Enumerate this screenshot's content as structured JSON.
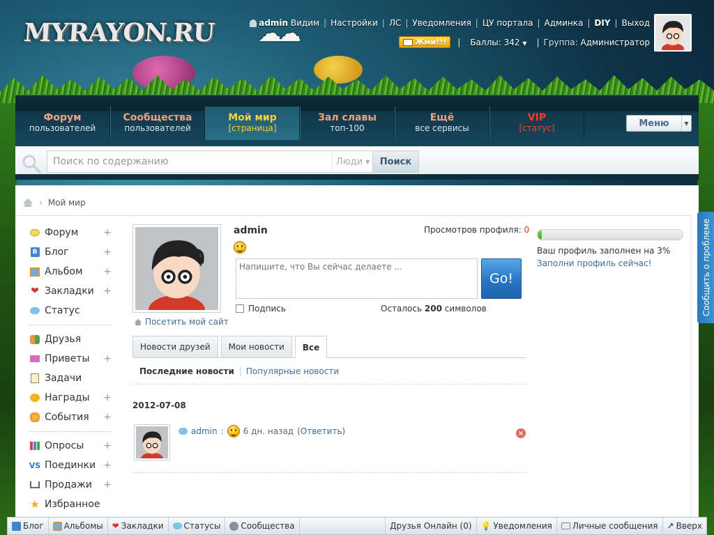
{
  "logo": "MYRAYON.RU",
  "top_bar": {
    "username": "admin",
    "links": [
      "Видим",
      "Настройки",
      "ЛС",
      "Уведомления",
      "ЦУ портала",
      "Админка",
      "DIY",
      "Выход"
    ],
    "push_button": "Жми!!!",
    "points_label": "Баллы: 342",
    "group_label": "Группа:",
    "group_value": "Администратор"
  },
  "main_nav": [
    {
      "title": "Форум",
      "subtitle": "пользователей"
    },
    {
      "title": "Сообщества",
      "subtitle": "пользователей"
    },
    {
      "title": "Мой мир",
      "subtitle": "[страница]"
    },
    {
      "title": "Зал славы",
      "subtitle": "топ-100"
    },
    {
      "title": "Ещё",
      "subtitle": "все сервисы"
    },
    {
      "title": "VIP",
      "subtitle": "[статус]"
    }
  ],
  "menu_button": "Меню",
  "search": {
    "placeholder": "Поиск по содержанию",
    "scope": "Люди",
    "button": "Поиск"
  },
  "breadcrumb": {
    "current": "Мой мир"
  },
  "left_menu": {
    "group1": [
      {
        "label": "Форум",
        "plus": "+"
      },
      {
        "label": "Блог",
        "plus": "+"
      },
      {
        "label": "Альбом",
        "plus": "+"
      },
      {
        "label": "Закладки",
        "plus": "+"
      },
      {
        "label": "Статус",
        "plus": ""
      }
    ],
    "group2": [
      {
        "label": "Друзья",
        "plus": ""
      },
      {
        "label": "Приветы",
        "plus": "+"
      },
      {
        "label": "Задачи",
        "plus": ""
      },
      {
        "label": "Награды",
        "plus": "+"
      },
      {
        "label": "События",
        "plus": "+"
      }
    ],
    "group3": [
      {
        "label": "Опросы",
        "plus": "+"
      },
      {
        "label": "Поединки",
        "plus": "+"
      },
      {
        "label": "Продажи",
        "plus": "+"
      },
      {
        "label": "Избранное",
        "plus": ""
      }
    ]
  },
  "profile": {
    "name": "admin",
    "views_label": "Просмотров профиля:",
    "views_count": "0",
    "status_placeholder": "Напишите, что Вы сейчас делаете ...",
    "go_button": "Go!",
    "sign_label": "Подпись",
    "chars_prefix": "Осталось",
    "chars_count": "200",
    "chars_suffix": "символов",
    "visit_site": "Посетить мой сайт",
    "completion_fraction": 0.03,
    "completion_text": "Ваш профиль заполнен на 3%",
    "completion_link": "Заполни профиль сейчас!"
  },
  "tabs": [
    "Новости друзей",
    "Мои новости",
    "Все"
  ],
  "subtabs": [
    "Последние новости",
    "Популярные новости"
  ],
  "feed": {
    "date": "2012-07-08",
    "user": "admin",
    "colon": ":",
    "time_ago": "6 дн. назад",
    "reply": "(Ответить)"
  },
  "feedback_tab": "Сообщить о проблеме",
  "bottom_bar": {
    "left": [
      "Блог",
      "Альбомы",
      "Закладки",
      "Статусы",
      "Сообщества"
    ],
    "right": [
      "Друзья Онлайн (0)",
      "Уведомления",
      "Личные сообщения",
      "Вверх"
    ]
  }
}
